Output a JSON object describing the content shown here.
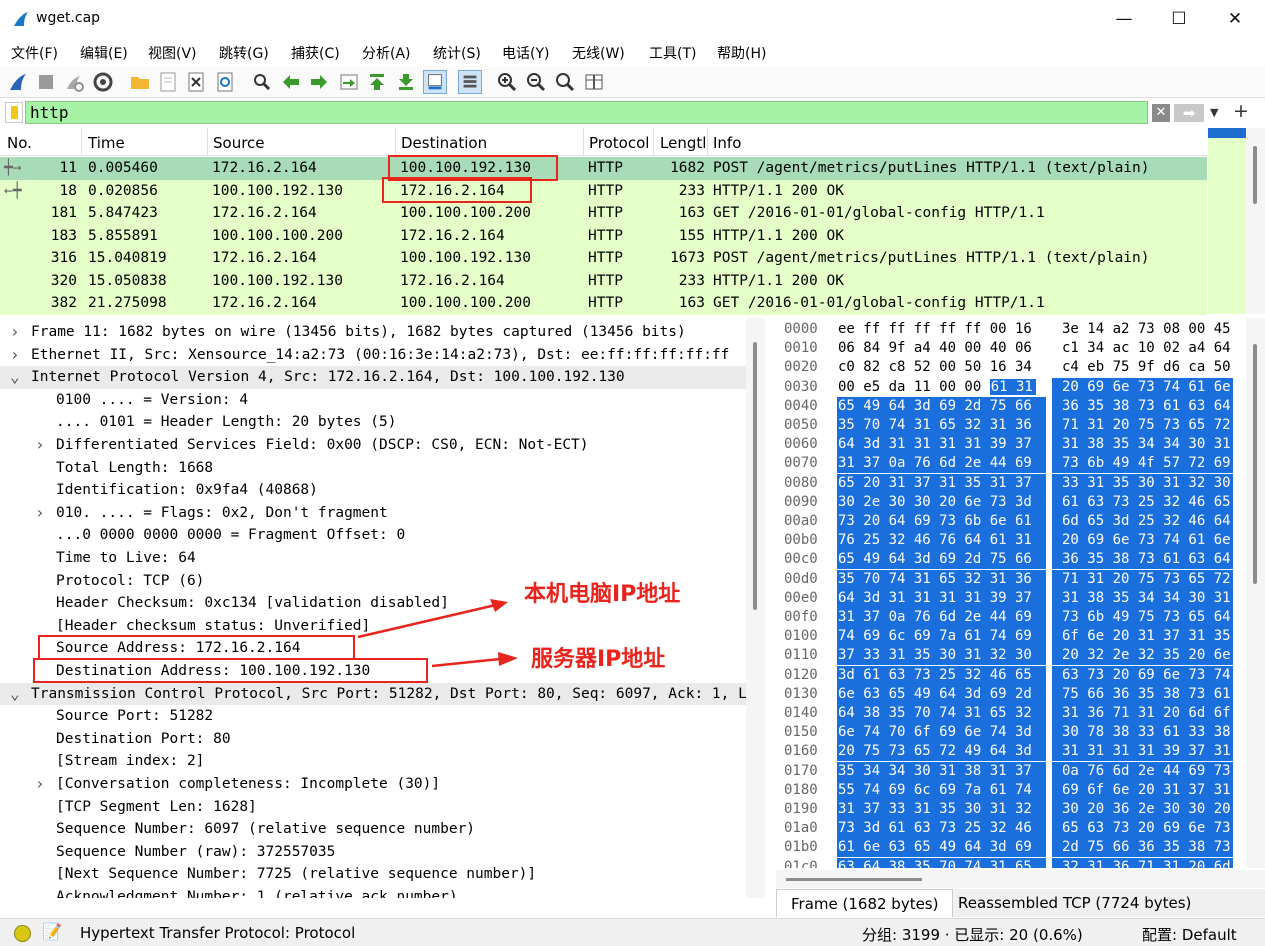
{
  "window": {
    "title": "wget.cap",
    "minimize": "—",
    "maximize": "☐",
    "close": "✕"
  },
  "menu": [
    "文件(F)",
    "编辑(E)",
    "视图(V)",
    "跳转(G)",
    "捕获(C)",
    "分析(A)",
    "统计(S)",
    "电话(Y)",
    "无线(W)",
    "工具(T)",
    "帮助(H)"
  ],
  "filter": {
    "value": "http"
  },
  "packet_list": {
    "columns": [
      "No.",
      "Time",
      "Source",
      "Destination",
      "Protocol",
      "Lengtl",
      "Info"
    ],
    "rows": [
      {
        "no": "11",
        "time": "0.005460",
        "src": "172.16.2.164",
        "dst": "100.100.192.130",
        "proto": "HTTP",
        "len": "1682",
        "info": "POST /agent/metrics/putLines HTTP/1.1  (text/plain)"
      },
      {
        "no": "18",
        "time": "0.020856",
        "src": "100.100.192.130",
        "dst": "172.16.2.164",
        "proto": "HTTP",
        "len": "233",
        "info": "HTTP/1.1 200 OK"
      },
      {
        "no": "181",
        "time": "5.847423",
        "src": "172.16.2.164",
        "dst": "100.100.100.200",
        "proto": "HTTP",
        "len": "163",
        "info": "GET /2016-01-01/global-config HTTP/1.1"
      },
      {
        "no": "183",
        "time": "5.855891",
        "src": "100.100.100.200",
        "dst": "172.16.2.164",
        "proto": "HTTP",
        "len": "155",
        "info": "HTTP/1.1 200 OK"
      },
      {
        "no": "316",
        "time": "15.040819",
        "src": "172.16.2.164",
        "dst": "100.100.192.130",
        "proto": "HTTP",
        "len": "1673",
        "info": "POST /agent/metrics/putLines HTTP/1.1  (text/plain)"
      },
      {
        "no": "320",
        "time": "15.050838",
        "src": "100.100.192.130",
        "dst": "172.16.2.164",
        "proto": "HTTP",
        "len": "233",
        "info": "HTTP/1.1 200 OK"
      },
      {
        "no": "382",
        "time": "21.275098",
        "src": "172.16.2.164",
        "dst": "100.100.100.200",
        "proto": "HTTP",
        "len": "163",
        "info": "GET /2016-01-01/global-config HTTP/1.1"
      }
    ]
  },
  "details": [
    {
      "tw": ">",
      "text": "Frame 11: 1682 bytes on wire (13456 bits), 1682 bytes captured (13456 bits)"
    },
    {
      "tw": ">",
      "text": "Ethernet II, Src: Xensource_14:a2:73 (00:16:3e:14:a2:73), Dst: ee:ff:ff:ff:ff:ff"
    },
    {
      "tw": "v",
      "text": "Internet Protocol Version 4, Src: 172.16.2.164, Dst: 100.100.192.130"
    },
    {
      "tw": "",
      "text": "0100 .... = Version: 4"
    },
    {
      "tw": "",
      "text": ".... 0101 = Header Length: 20 bytes (5)"
    },
    {
      "tw": ">",
      "text": "Differentiated Services Field: 0x00 (DSCP: CS0, ECN: Not-ECT)"
    },
    {
      "tw": "",
      "text": "Total Length: 1668"
    },
    {
      "tw": "",
      "text": "Identification: 0x9fa4 (40868)"
    },
    {
      "tw": ">",
      "text": "010. .... = Flags: 0x2, Don't fragment"
    },
    {
      "tw": "",
      "text": "...0 0000 0000 0000 = Fragment Offset: 0"
    },
    {
      "tw": "",
      "text": "Time to Live: 64"
    },
    {
      "tw": "",
      "text": "Protocol: TCP (6)"
    },
    {
      "tw": "",
      "text": "Header Checksum: 0xc134 [validation disabled]"
    },
    {
      "tw": "",
      "text": "[Header checksum status: Unverified]"
    },
    {
      "tw": "",
      "text": "Source Address: 172.16.2.164"
    },
    {
      "tw": "",
      "text": "Destination Address: 100.100.192.130"
    },
    {
      "tw": "v",
      "text": "Transmission Control Protocol, Src Port: 51282, Dst Port: 80, Seq: 6097, Ack: 1, Len: 1628"
    },
    {
      "tw": "",
      "text": "Source Port: 51282"
    },
    {
      "tw": "",
      "text": "Destination Port: 80"
    },
    {
      "tw": "",
      "text": "[Stream index: 2]"
    },
    {
      "tw": ">",
      "text": "[Conversation completeness: Incomplete (30)]"
    },
    {
      "tw": "",
      "text": "[TCP Segment Len: 1628]"
    },
    {
      "tw": "",
      "text": "Sequence Number: 6097    (relative sequence number)"
    },
    {
      "tw": "",
      "text": "Sequence Number (raw): 372557035"
    },
    {
      "tw": "",
      "text": "[Next Sequence Number: 7725    (relative sequence number)]"
    },
    {
      "tw": "",
      "text": "Acknowledgment Number: 1    (relative ack number)"
    }
  ],
  "bytes": [
    {
      "off": "0000",
      "g1": "ee ff ff ff ff ff 00 16",
      "g2": "3e 14 a2 73 08 00 45"
    },
    {
      "off": "0010",
      "g1": "06 84 9f a4 40 00 40 06",
      "g2": "c1 34 ac 10 02 a4 64"
    },
    {
      "off": "0020",
      "g1": "c0 82 c8 52 00 50 16 34",
      "g2": "c4 eb 75 9f d6 ca 50"
    },
    {
      "off": "0030",
      "g1a": "00 e5 da 11 00 00 ",
      "g1b": "61 31",
      "g2": "20 69 6e 73 74 61 6e"
    },
    {
      "off": "0040",
      "g1": "65 49 64 3d 69 2d 75 66",
      "g2": "36 35 38 73 61 63 64"
    },
    {
      "off": "0050",
      "g1": "35 70 74 31 65 32 31 36",
      "g2": "71 31 20 75 73 65 72"
    },
    {
      "off": "0060",
      "g1": "64 3d 31 31 31 31 39 37",
      "g2": "31 38 35 34 34 30 31"
    },
    {
      "off": "0070",
      "g1": "31 37 0a 76 6d 2e 44 69",
      "g2": "73 6b 49 4f 57 72 69"
    },
    {
      "off": "0080",
      "g1": "65 20 31 37 31 35 31 37",
      "g2": "33 31 35 30 31 32 30"
    },
    {
      "off": "0090",
      "g1": "30 2e 30 30 20 6e 73 3d",
      "g2": "61 63 73 25 32 46 65"
    },
    {
      "off": "00a0",
      "g1": "73 20 64 69 73 6b 6e 61",
      "g2": "6d 65 3d 25 32 46 64"
    },
    {
      "off": "00b0",
      "g1": "76 25 32 46 76 64 61 31",
      "g2": "20 69 6e 73 74 61 6e"
    },
    {
      "off": "00c0",
      "g1": "65 49 64 3d 69 2d 75 66",
      "g2": "36 35 38 73 61 63 64"
    },
    {
      "off": "00d0",
      "g1": "35 70 74 31 65 32 31 36",
      "g2": "71 31 20 75 73 65 72"
    },
    {
      "off": "00e0",
      "g1": "64 3d 31 31 31 31 39 37",
      "g2": "31 38 35 34 34 30 31"
    },
    {
      "off": "00f0",
      "g1": "31 37 0a 76 6d 2e 44 69",
      "g2": "73 6b 49 75 73 65 64"
    },
    {
      "off": "0100",
      "g1": "74 69 6c 69 7a 61 74 69",
      "g2": "6f 6e 20 31 37 31 35"
    },
    {
      "off": "0110",
      "g1": "37 33 31 35 30 31 32 30",
      "g2": "20 32 2e 32 35 20 6e"
    },
    {
      "off": "0120",
      "g1": "3d 61 63 73 25 32 46 65",
      "g2": "63 73 20 69 6e 73 74"
    },
    {
      "off": "0130",
      "g1": "6e 63 65 49 64 3d 69 2d",
      "g2": "75 66 36 35 38 73 61"
    },
    {
      "off": "0140",
      "g1": "64 38 35 70 74 31 65 32",
      "g2": "31 36 71 31 20 6d 6f"
    },
    {
      "off": "0150",
      "g1": "6e 74 70 6f 69 6e 74 3d",
      "g2": "30 78 38 33 61 33 38"
    },
    {
      "off": "0160",
      "g1": "20 75 73 65 72 49 64 3d",
      "g2": "31 31 31 31 39 37 31"
    },
    {
      "off": "0170",
      "g1": "35 34 34 30 31 38 31 37",
      "g2": "0a 76 6d 2e 44 69 73"
    },
    {
      "off": "0180",
      "g1": "55 74 69 6c 69 7a 61 74",
      "g2": "69 6f 6e 20 31 37 31"
    },
    {
      "off": "0190",
      "g1": "31 37 33 31 35 30 31 32",
      "g2": "30 20 36 2e 30 30 20"
    },
    {
      "off": "01a0",
      "g1": "73 3d 61 63 73 25 32 46",
      "g2": "65 63 73 20 69 6e 73"
    },
    {
      "off": "01b0",
      "g1": "61 6e 63 65 49 64 3d 69",
      "g2": "2d 75 66 36 35 38 73"
    },
    {
      "off": "01c0",
      "g1": "63 64 38 35 70 74 31 65",
      "g2": "32 31 36 71 31 20 6d"
    }
  ],
  "byte_tabs": [
    "Frame (1682 bytes)",
    "Reassembled TCP (7724 bytes)"
  ],
  "status": {
    "message": "Hypertext Transfer Protocol: Protocol",
    "stats": "分组: 3199 · 已显示: 20 (0.6%)",
    "profile": "配置: Default"
  },
  "annotations": {
    "local_ip": "本机电脑IP地址",
    "server_ip": "服务器IP地址",
    "color": "#e8241c"
  },
  "colors": {
    "http_row": "#e4ffc7",
    "selected_row": "#a8dcb8",
    "filter_ok": "#a6f3a6",
    "byte_selection": "#1a6fdc"
  }
}
